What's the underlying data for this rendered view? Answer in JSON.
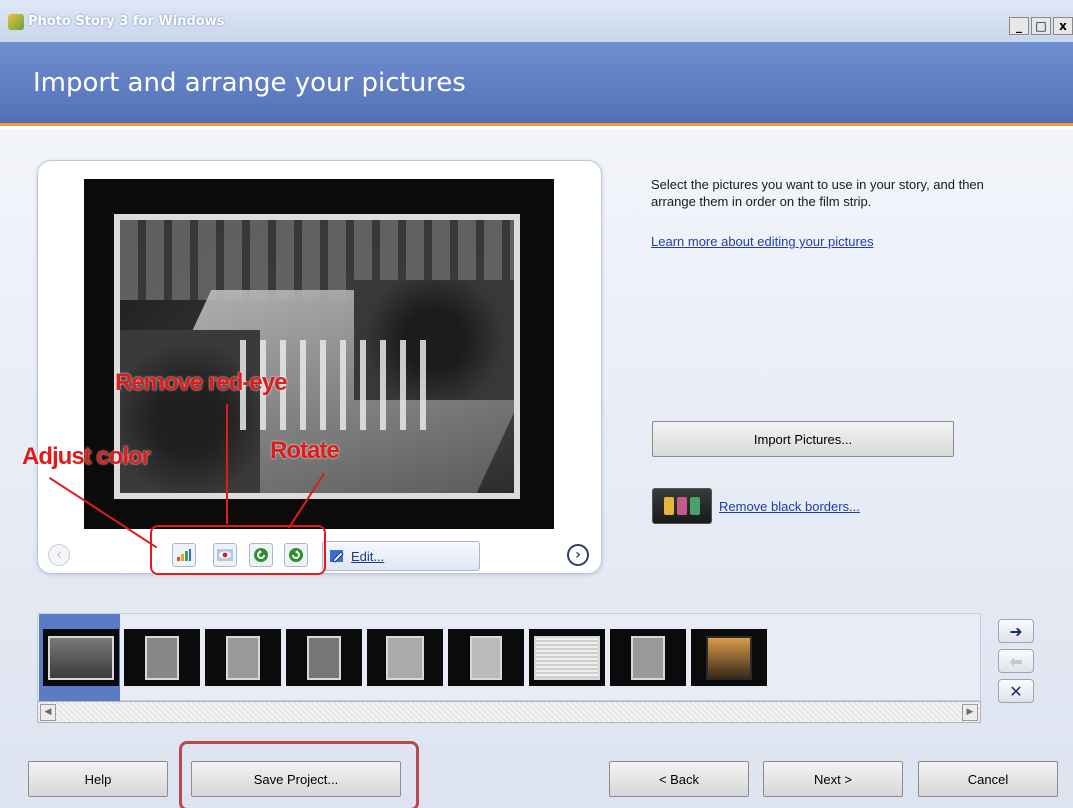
{
  "window": {
    "title": "Photo Story 3 for Windows",
    "buttons": {
      "minimize": "_",
      "maximize": "□",
      "close": "x"
    }
  },
  "header": {
    "page_title": "Import and arrange your pictures"
  },
  "preview": {
    "prev_icon": "‹",
    "next_icon": "›",
    "toolbar": {
      "adjust_color_icon": "bar-chart-icon",
      "red_eye_icon": "eye-icon",
      "rotate_left_icon": "rotate-left-icon",
      "rotate_right_icon": "rotate-right-icon",
      "edit_label": "Edit..."
    }
  },
  "annotations": {
    "remove_red_eye": "Remove red-eye",
    "adjust_color": "Adjust color",
    "rotate": "Rotate",
    "color": "#e01b1b"
  },
  "instructions": {
    "text": "Select the pictures you want to use in your story, and then arrange them in order on the film strip.",
    "learn_link": "Learn more about editing your pictures"
  },
  "actions": {
    "import_pictures": "Import Pictures...",
    "remove_black_borders": "Remove black borders..."
  },
  "filmstrip": {
    "thumbnails": [
      "thumbnail-1",
      "thumbnail-2",
      "thumbnail-3",
      "thumbnail-4",
      "thumbnail-5",
      "thumbnail-6",
      "thumbnail-7",
      "thumbnail-8",
      "thumbnail-9"
    ],
    "selected_index": 0,
    "side_buttons": {
      "move_right": "➜",
      "move_left": "⬅",
      "delete": "✕"
    },
    "scroll_left": "◀",
    "scroll_right": "▶"
  },
  "footer": {
    "help": "Help",
    "save_project": "Save Project...",
    "back": "< Back",
    "next": "Next >",
    "cancel": "Cancel"
  },
  "colors": {
    "header_blue": "#5e7cc2",
    "accent_orange": "#e5a13d",
    "link_blue": "#1e3fa8"
  }
}
